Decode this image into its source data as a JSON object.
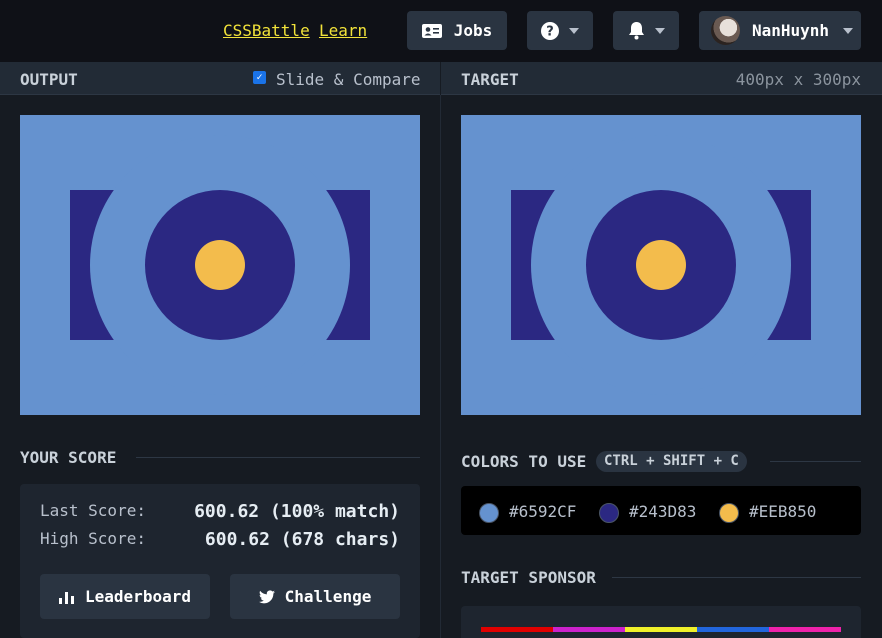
{
  "topbar": {
    "links": [
      "CSSBattle",
      "Learn"
    ],
    "jobs_label": "Jobs",
    "help_icon": "question-circle-icon",
    "bell_icon": "bell-icon",
    "user_name": "NanHuynh"
  },
  "output_panel": {
    "title": "OUTPUT",
    "compare_label": "Slide & Compare",
    "compare_checked": true
  },
  "target_panel": {
    "title": "TARGET",
    "size": "400px x 300px"
  },
  "score": {
    "title": "YOUR SCORE",
    "last_label": "Last Score:",
    "last_value": "600.62 (100% match)",
    "high_label": "High Score:",
    "high_value": "600.62 (678 chars)",
    "leaderboard_label": "Leaderboard",
    "challenge_label": "Challenge"
  },
  "colors": {
    "title": "COLORS TO USE",
    "shortcut": "CTRL + SHIFT + C",
    "items": [
      "#6592CF",
      "#243D83",
      "#EEB850"
    ]
  },
  "sponsor": {
    "title": "TARGET SPONSOR",
    "stripe_colors": [
      "#e00000",
      "#cc22cc",
      "#f0f02a",
      "#2266dd",
      "#ee22aa"
    ]
  },
  "palette": {
    "background": "#6592cf",
    "dark_blue": "#2b2882",
    "yellow": "#f3bc4c"
  }
}
